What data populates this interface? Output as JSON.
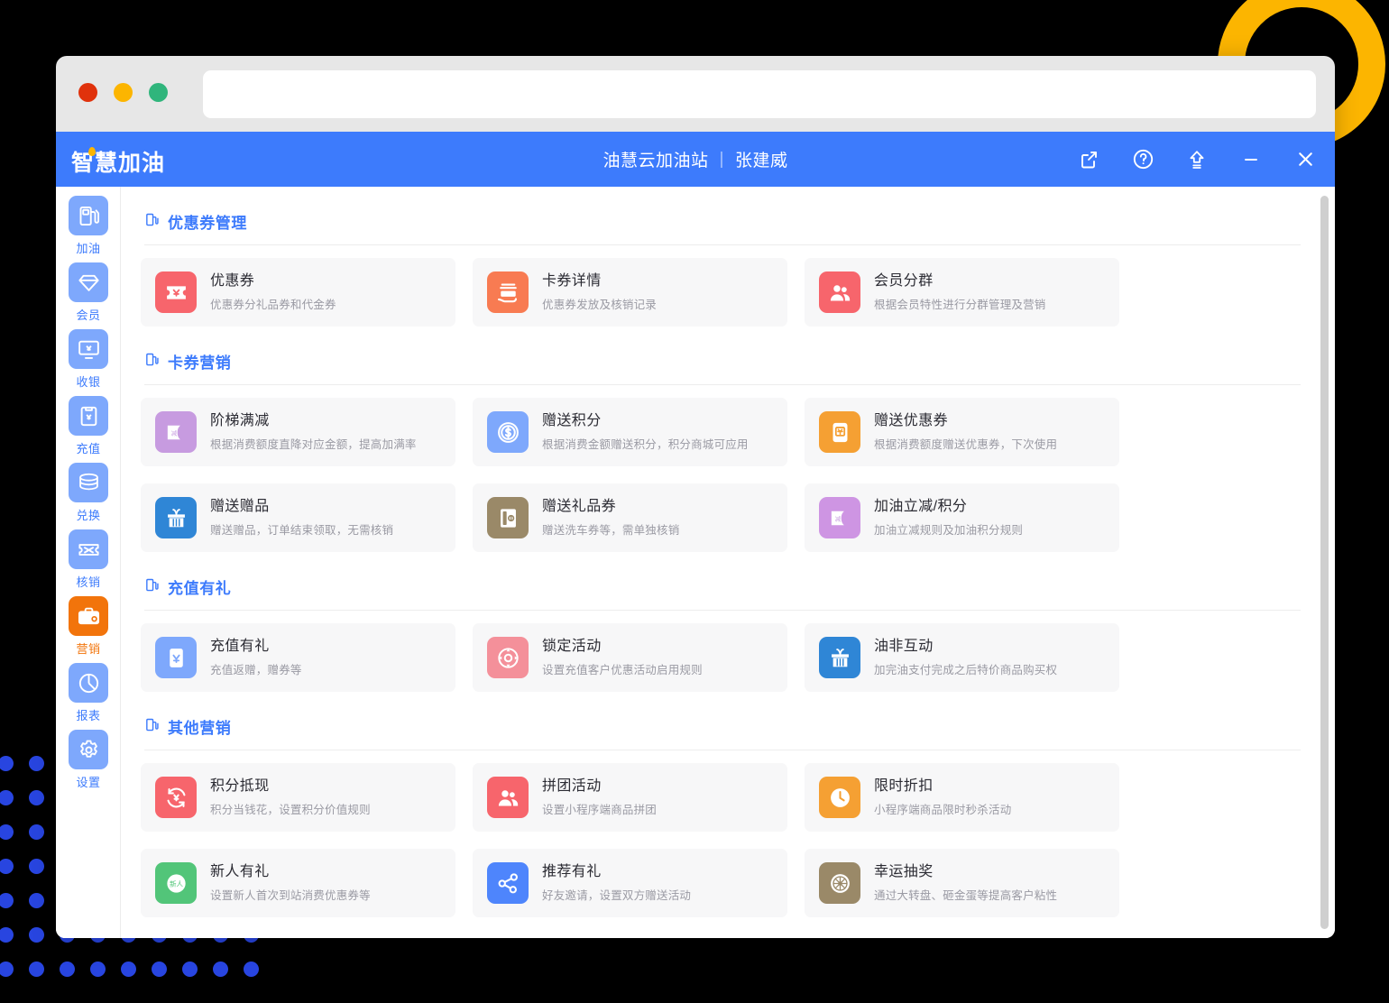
{
  "decor": {
    "ring_color": "#FCB500",
    "dot_color": "#2845E0"
  },
  "browser": {
    "traffic_lights": [
      "close",
      "minimize",
      "maximize"
    ],
    "url_value": "",
    "url_placeholder": ""
  },
  "appbar": {
    "logo": "智慧加油",
    "station": "油慧云加油站",
    "separator": "|",
    "user": "张建威",
    "actions": [
      {
        "name": "open-external-icon",
        "label": "外部打开"
      },
      {
        "name": "help-icon",
        "label": "帮助"
      },
      {
        "name": "upgrade-icon",
        "label": "升级"
      },
      {
        "name": "minimize-icon",
        "label": "最小化"
      },
      {
        "name": "close-icon",
        "label": "关闭"
      }
    ]
  },
  "sidebar": {
    "items": [
      {
        "label": "加油",
        "icon": "fuel-pump-icon",
        "active": false
      },
      {
        "label": "会员",
        "icon": "diamond-icon",
        "active": false
      },
      {
        "label": "收银",
        "icon": "monitor-yuan-icon",
        "active": false
      },
      {
        "label": "充值",
        "icon": "clipboard-yuan-icon",
        "active": false
      },
      {
        "label": "兑换",
        "icon": "coins-stack-icon",
        "active": false
      },
      {
        "label": "核销",
        "icon": "ticket-icon",
        "active": false
      },
      {
        "label": "营销",
        "icon": "briefcase-icon",
        "active": true
      },
      {
        "label": "报表",
        "icon": "pie-chart-icon",
        "active": false
      },
      {
        "label": "设置",
        "icon": "gear-icon",
        "active": false
      }
    ]
  },
  "sections": [
    {
      "title": "优惠券管理",
      "cards": [
        {
          "title": "优惠券",
          "desc": "优惠券分礼品券和代金券",
          "icon": "coupon-yuan-icon",
          "color": "#F7656C"
        },
        {
          "title": "卡券详情",
          "desc": "优惠券发放及核销记录",
          "icon": "card-hand-icon",
          "color": "#F87B52"
        },
        {
          "title": "会员分群",
          "desc": "根据会员特性进行分群管理及营销",
          "icon": "users-icon",
          "color": "#F7656C"
        }
      ]
    },
    {
      "title": "卡券营销",
      "cards": [
        {
          "title": "阶梯满减",
          "desc": "根据消费额度直降对应金额，提高加满率",
          "icon": "discount-card-icon",
          "color": "#C79BE0"
        },
        {
          "title": "赠送积分",
          "desc": "根据消费金额赠送积分，积分商城可应用",
          "icon": "coin-dollar-icon",
          "color": "#7EA8FC"
        },
        {
          "title": "赠送优惠券",
          "desc": "根据消费额度赠送优惠券，下次使用",
          "icon": "gift-coupon-icon",
          "color": "#F5A033"
        },
        {
          "title": "赠送赠品",
          "desc": "赠送赠品，订单结束领取，无需核销",
          "icon": "gift-box-icon",
          "color": "#2F86D6"
        },
        {
          "title": "赠送礼品券",
          "desc": "赠送洗车券等，需单独核销",
          "icon": "voucher-icon",
          "color": "#9A8968"
        },
        {
          "title": "加油立减/积分",
          "desc": "加油立减规则及加油积分规则",
          "icon": "discount-card-icon",
          "color": "#CE95E3"
        }
      ]
    },
    {
      "title": "充值有礼",
      "cards": [
        {
          "title": "充值有礼",
          "desc": "充值返赠，赠券等",
          "icon": "recharge-yuan-icon",
          "color": "#7EA8FC"
        },
        {
          "title": "锁定活动",
          "desc": "设置充值客户优惠活动启用规则",
          "icon": "lock-target-icon",
          "color": "#F4909A"
        },
        {
          "title": "油非互动",
          "desc": "加完油支付完成之后特价商品购买权",
          "icon": "gift-box-icon",
          "color": "#2F86D6"
        }
      ]
    },
    {
      "title": "其他营销",
      "cards": [
        {
          "title": "积分抵现",
          "desc": "积分当钱花，设置积分价值规则",
          "icon": "points-cash-icon",
          "color": "#F7656C"
        },
        {
          "title": "拼团活动",
          "desc": "设置小程序端商品拼团",
          "icon": "users-icon",
          "color": "#F7656C"
        },
        {
          "title": "限时折扣",
          "desc": "小程序端商品限时秒杀活动",
          "icon": "clock-icon",
          "color": "#F5A033"
        },
        {
          "title": "新人有礼",
          "desc": "设置新人首次到站消费优惠券等",
          "icon": "newcomer-icon",
          "color": "#52C579"
        },
        {
          "title": "推荐有礼",
          "desc": "好友邀请，设置双方赠送活动",
          "icon": "share-icon",
          "color": "#4E85FC"
        },
        {
          "title": "幸运抽奖",
          "desc": "通过大转盘、砸金蛋等提高客户粘性",
          "icon": "wheel-icon",
          "color": "#9A8968"
        }
      ]
    }
  ]
}
